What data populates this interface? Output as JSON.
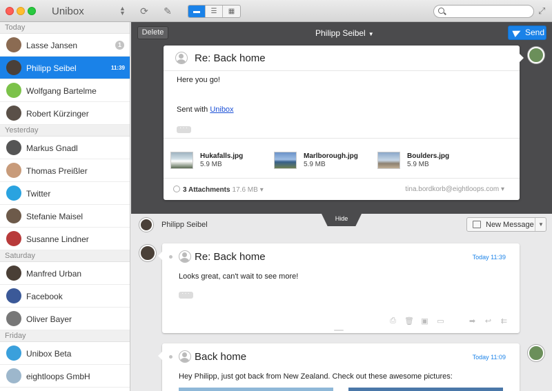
{
  "app": {
    "title": "Unibox"
  },
  "toolbar": {
    "refresh_icon": "refresh-icon",
    "compose_icon": "compose-icon",
    "views": [
      "single-view-icon",
      "list-view-icon",
      "grid-view-icon"
    ],
    "search_placeholder": "",
    "search_value": ""
  },
  "sidebar": {
    "sections": [
      {
        "label": "Today",
        "items": [
          {
            "name": "Lasse Jansen",
            "badge": "1",
            "color": "#8b6b52"
          },
          {
            "name": "Philipp Seibel",
            "time": "11:39",
            "selected": true,
            "color": "#4a4038"
          },
          {
            "name": "Wolfgang Bartelme",
            "color": "#7cc24a"
          },
          {
            "name": "Robert Kürzinger",
            "color": "#5a5048"
          }
        ]
      },
      {
        "label": "Yesterday",
        "items": [
          {
            "name": "Markus Gnadl",
            "color": "#555555"
          },
          {
            "name": "Thomas Preißler",
            "color": "#c89b7a"
          },
          {
            "name": "Twitter",
            "color": "#2aa3e0"
          },
          {
            "name": "Stefanie Maisel",
            "color": "#6d5a4a"
          },
          {
            "name": "Susanne Lindner",
            "color": "#b83a3a"
          }
        ]
      },
      {
        "label": "Saturday",
        "items": [
          {
            "name": "Manfred Urban",
            "color": "#4a3f36"
          },
          {
            "name": "Facebook",
            "color": "#3b5998"
          },
          {
            "name": "Oliver Bayer",
            "color": "#777777"
          }
        ]
      },
      {
        "label": "Friday",
        "items": [
          {
            "name": "Unibox Beta",
            "color": "#3aa0dc"
          },
          {
            "name": "eightloops GmbH",
            "color": "#9db7cc"
          }
        ]
      }
    ]
  },
  "compose": {
    "delete_label": "Delete",
    "recipient": "Philipp Seibel",
    "send_label": "Send",
    "subject": "Re: Back home",
    "body_line1": "Here you go!",
    "signature_prefix": "Sent with ",
    "signature_link": "Unibox",
    "attachments": [
      {
        "name": "Hukafalls.jpg",
        "size": "5.9 MB"
      },
      {
        "name": "Marlborough.jpg",
        "size": "5.9 MB"
      },
      {
        "name": "Boulders.jpg",
        "size": "5.9 MB"
      }
    ],
    "attachments_count": "3 Attachments",
    "attachments_total": "17.6 MB",
    "from_address": "tina.bordkorb@eightloops.com",
    "hide_label": "Hide"
  },
  "thread": {
    "contact": "Philipp Seibel",
    "new_message_label": "New Message",
    "messages": [
      {
        "subject": "Re: Back home",
        "time": "Today 11:39",
        "body": "Looks great, can't wait to see more!"
      },
      {
        "subject": "Back home",
        "time": "Today 11:09",
        "body": "Hey Philipp, just got back from New Zealand. Check out these awesome pictures:"
      }
    ]
  },
  "colors": {
    "accent": "#1a82e8",
    "compose_bg": "#4b4b4d"
  }
}
